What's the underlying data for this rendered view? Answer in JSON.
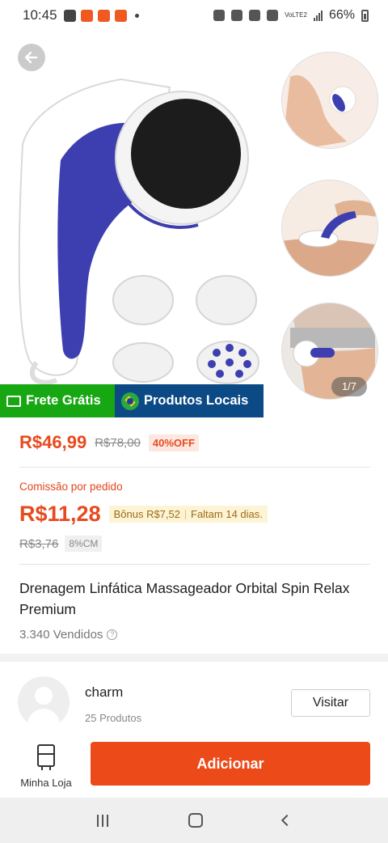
{
  "status_bar": {
    "time": "10:45",
    "battery": "66%",
    "volte": "VoLTE2"
  },
  "gallery": {
    "counter": "1/7",
    "badges": {
      "frete": "Frete Grátis",
      "locais": "Produtos Locais"
    }
  },
  "pricing": {
    "price": "R$46,99",
    "old_price": "R$78,00",
    "discount": "40%OFF"
  },
  "commission": {
    "label": "Comissão por pedido",
    "amount": "R$11,28",
    "bonus": "Bônus R$7,52",
    "remaining": "Faltam 14 dias.",
    "old_amount": "R$3,76",
    "rate": "8%CM"
  },
  "product": {
    "title": "Drenagem Linfática Massageador Orbital Spin Relax Premium",
    "sold": "3.340 Vendidos",
    "help_glyph": "?"
  },
  "shop": {
    "name": "charm",
    "products": "25 Produtos",
    "visit_label": "Visitar"
  },
  "actions": {
    "store_label": "Minha Loja",
    "add_label": "Adicionar"
  },
  "colors": {
    "accent": "#ec4a18",
    "frete_green": "#16a713",
    "locais_blue": "#0c4a86",
    "price": "#e8491e"
  }
}
